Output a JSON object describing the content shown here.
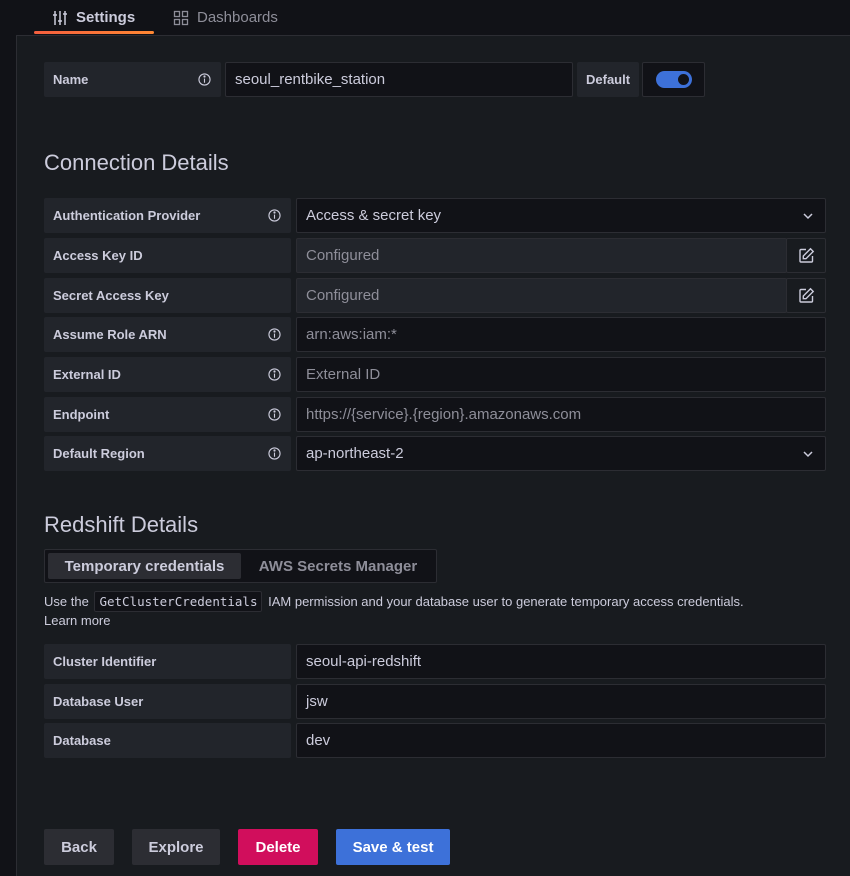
{
  "tabs": [
    {
      "label": "Settings",
      "icon": "sliders-icon"
    },
    {
      "label": "Dashboards",
      "icon": "grid-icon"
    }
  ],
  "name_field": {
    "label": "Name",
    "value": "seoul_rentbike_station",
    "default_label": "Default",
    "default_on": true
  },
  "connection": {
    "title": "Connection Details",
    "auth_provider": {
      "label": "Authentication Provider",
      "value": "Access & secret key"
    },
    "access_key_id": {
      "label": "Access Key ID",
      "value": "Configured"
    },
    "secret_access_key": {
      "label": "Secret Access Key",
      "value": "Configured"
    },
    "assume_role_arn": {
      "label": "Assume Role ARN",
      "placeholder": "arn:aws:iam:*"
    },
    "external_id": {
      "label": "External ID",
      "placeholder": "External ID"
    },
    "endpoint": {
      "label": "Endpoint",
      "placeholder": "https://{service}.{region}.amazonaws.com"
    },
    "default_region": {
      "label": "Default Region",
      "value": "ap-northeast-2"
    }
  },
  "redshift": {
    "title": "Redshift Details",
    "mode_tabs": [
      "Temporary credentials",
      "AWS Secrets Manager"
    ],
    "help_prefix": "Use the",
    "help_code": "GetClusterCredentials",
    "help_suffix": "IAM permission and your database user to generate temporary access credentials.",
    "learn_more": "Learn more",
    "cluster_identifier": {
      "label": "Cluster Identifier",
      "value": "seoul-api-redshift"
    },
    "database_user": {
      "label": "Database User",
      "value": "jsw"
    },
    "database": {
      "label": "Database",
      "value": "dev"
    }
  },
  "buttons": {
    "back": "Back",
    "explore": "Explore",
    "delete": "Delete",
    "save": "Save & test"
  },
  "colors": {
    "primary": "#3d71d9",
    "destructive": "#d10e5c",
    "toggle": "#3d71d9",
    "tab_accent": "#f55f3e"
  }
}
